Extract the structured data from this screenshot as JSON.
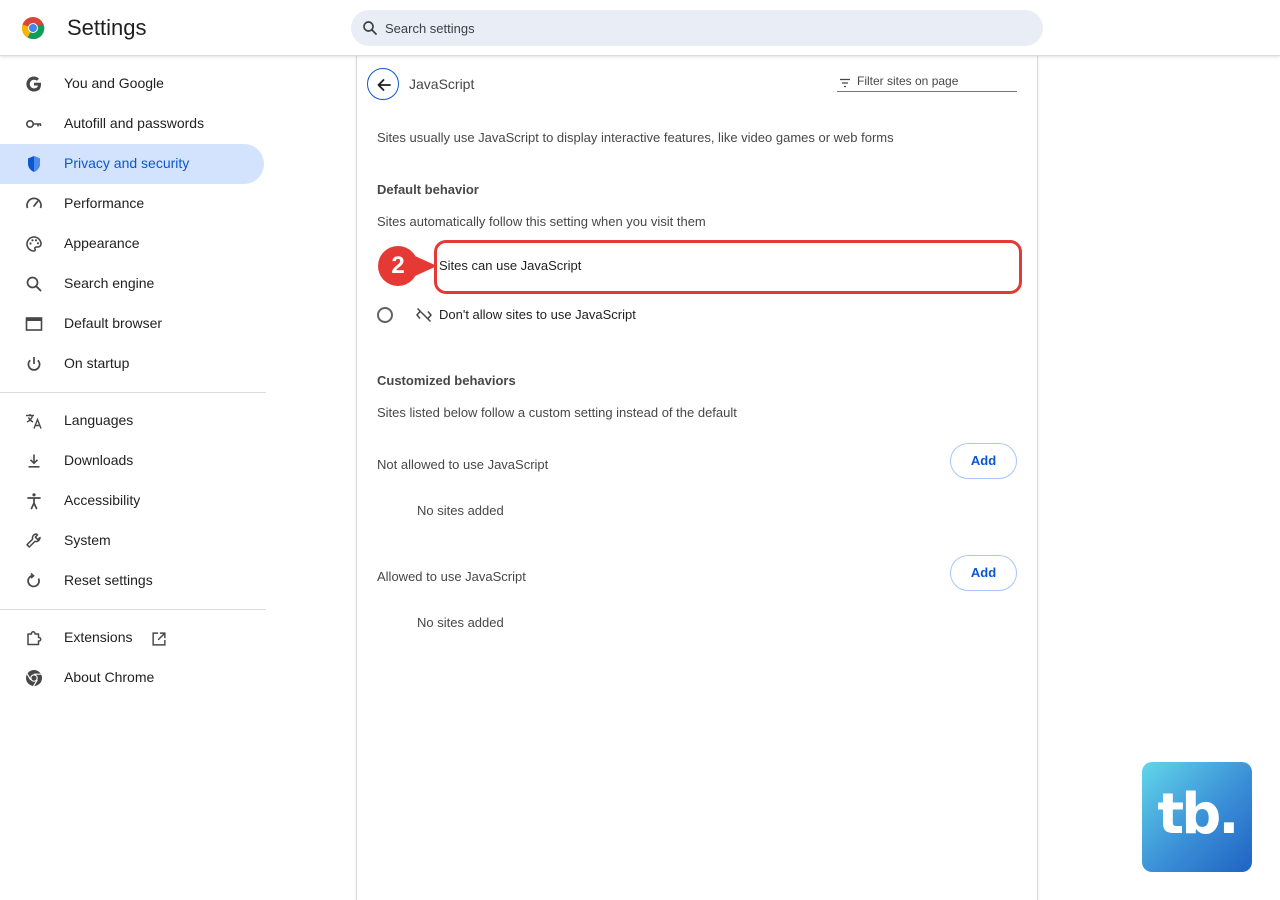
{
  "header": {
    "title": "Settings",
    "search_placeholder": "Search settings"
  },
  "sidebar": {
    "items": [
      {
        "label": "You and Google",
        "icon": "google-g-icon"
      },
      {
        "label": "Autofill and passwords",
        "icon": "key-icon"
      },
      {
        "label": "Privacy and security",
        "icon": "shield-icon",
        "active": true
      },
      {
        "label": "Performance",
        "icon": "speedometer-icon"
      },
      {
        "label": "Appearance",
        "icon": "palette-icon"
      },
      {
        "label": "Search engine",
        "icon": "search-icon"
      },
      {
        "label": "Default browser",
        "icon": "browser-window-icon"
      },
      {
        "label": "On startup",
        "icon": "power-icon"
      },
      {
        "label": "Languages",
        "icon": "translate-icon"
      },
      {
        "label": "Downloads",
        "icon": "download-icon"
      },
      {
        "label": "Accessibility",
        "icon": "accessibility-icon"
      },
      {
        "label": "System",
        "icon": "wrench-icon"
      },
      {
        "label": "Reset settings",
        "icon": "reset-icon"
      },
      {
        "label": "Extensions",
        "icon": "puzzle-icon"
      },
      {
        "label": "About Chrome",
        "icon": "chrome-icon"
      }
    ]
  },
  "page": {
    "title": "JavaScript",
    "filter_placeholder": "Filter sites on page",
    "description": "Sites usually use JavaScript to display interactive features, like video games or web forms",
    "default_behavior": {
      "heading": "Default behavior",
      "subtitle": "Sites automatically follow this setting when you visit them",
      "options": [
        {
          "label": "Sites can use JavaScript",
          "selected": true
        },
        {
          "label": "Don't allow sites to use JavaScript",
          "selected": false
        }
      ]
    },
    "customized": {
      "heading": "Customized behaviors",
      "subtitle": "Sites listed below follow a custom setting instead of the default",
      "lists": [
        {
          "label": "Not allowed to use JavaScript",
          "add_label": "Add",
          "empty_text": "No sites added"
        },
        {
          "label": "Allowed to use JavaScript",
          "add_label": "Add",
          "empty_text": "No sites added"
        }
      ]
    }
  },
  "annotation": {
    "step_number": "2",
    "color": "#e53935"
  },
  "brand": {
    "text": "tb."
  },
  "colors": {
    "accent": "#0b57d0",
    "active_nav_bg": "#d3e3fd",
    "search_bg": "#e9eef6"
  }
}
